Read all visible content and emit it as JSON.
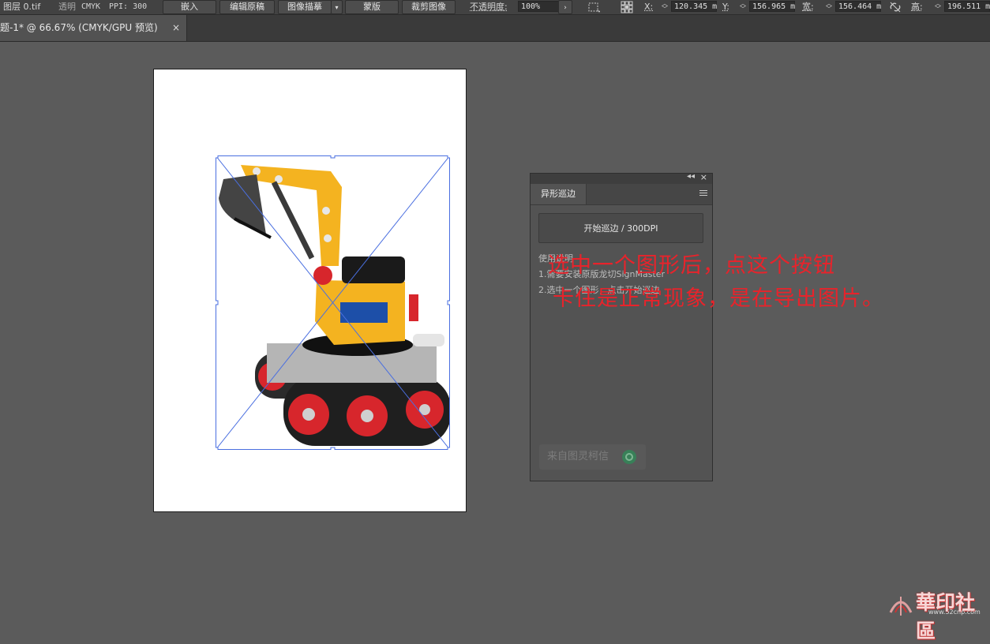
{
  "control_bar": {
    "layer_label": "图层 0.tif",
    "transparency_label": "透明",
    "color_mode": "CMYK",
    "ppi": "PPI: 300",
    "embed_label": "嵌入",
    "edit_original_label": "编辑原稿",
    "image_trace_label": "图像描摹",
    "mask_label": "蒙版",
    "crop_label": "裁剪图像",
    "opacity_label": "不透明度:",
    "opacity_value": "100%",
    "x_label": "X:",
    "x_value": "120.345 m",
    "y_label": "Y:",
    "y_value": "156.965 m",
    "width_label": "宽:",
    "width_value": "156.464 m",
    "height_label": "高:",
    "height_value": "196.511 m"
  },
  "document_tab": {
    "title": "题-1* @ 66.67% (CMYK/GPU 预览)",
    "close": "×"
  },
  "panel": {
    "tab_label": "异形巡边",
    "collapse_glyph": "◂◂",
    "close_glyph": "×",
    "scan_button_label": "开始巡边 / 300DPI",
    "usage_title": "使用说明",
    "usage_lines": [
      "1.需要安装原版龙切SignMaster",
      "2.选中一个图形，点击开始巡边"
    ],
    "credit_label": "来自图灵柯信"
  },
  "annotation": {
    "line1": "选中一个图形后，点这个按钮",
    "line2": "卡住是正常现象，是在导出图片。"
  },
  "watermark": {
    "text": "華印社區",
    "url": "www.52cnp.com"
  },
  "colors": {
    "annotation_red": "#e8232b",
    "selection_blue": "#4a6fe0",
    "toy_yellow": "#f4b320",
    "toy_red": "#d7262c"
  }
}
